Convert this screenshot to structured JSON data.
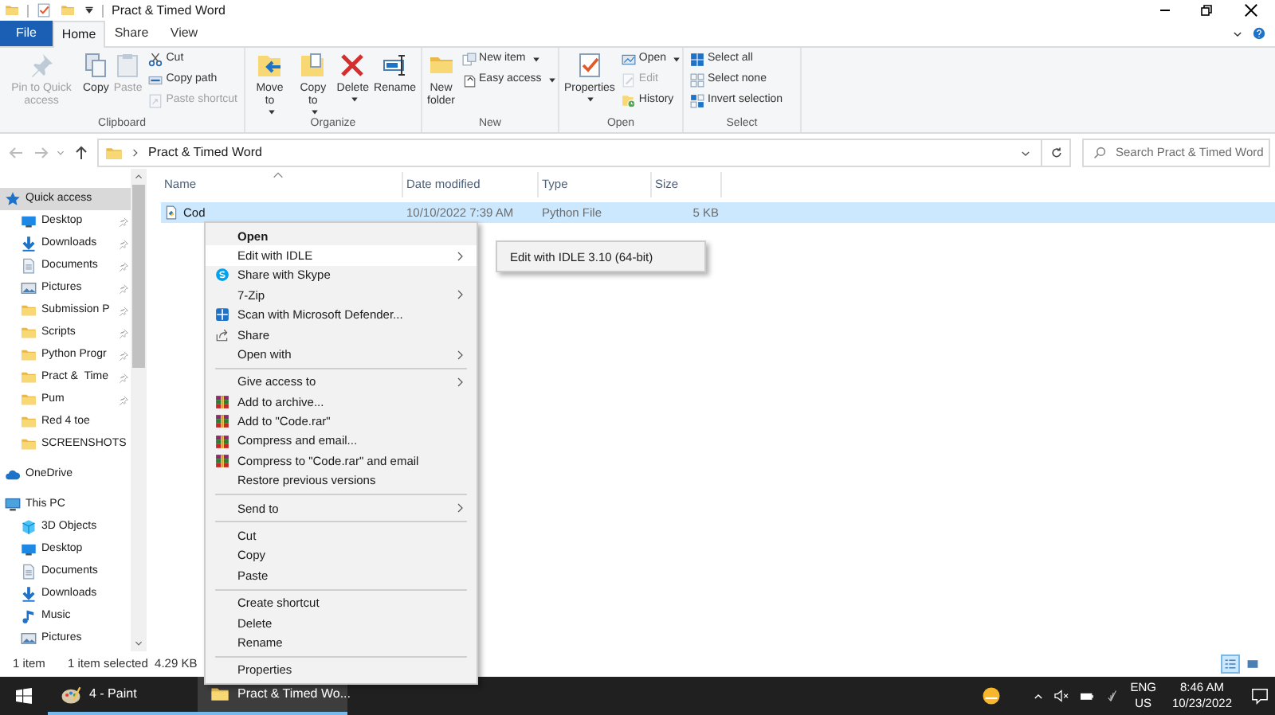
{
  "title_bar": {
    "title": "Pract & Timed Word"
  },
  "ribbon": {
    "tabs": [
      {
        "label": "File",
        "kind": "file",
        "selected": false
      },
      {
        "label": "Home",
        "kind": "tab",
        "selected": true
      },
      {
        "label": "Share",
        "kind": "tab",
        "selected": false
      },
      {
        "label": "View",
        "kind": "tab",
        "selected": false
      }
    ],
    "groups": [
      {
        "label": "Clipboard",
        "items": [
          {
            "label": "Pin to Quick access",
            "kind": "large",
            "dropdown": false,
            "disabled": true
          },
          {
            "label": "Copy",
            "kind": "large",
            "dropdown": false,
            "disabled": false
          },
          {
            "label": "Paste",
            "kind": "large",
            "dropdown": false,
            "disabled": true
          },
          {
            "label": "Cut",
            "kind": "small",
            "dropdown": false,
            "disabled": false
          },
          {
            "label": "Copy path",
            "kind": "small",
            "dropdown": false,
            "disabled": false
          },
          {
            "label": "Paste shortcut",
            "kind": "small",
            "dropdown": false,
            "disabled": true
          }
        ]
      },
      {
        "label": "Organize",
        "items": [
          {
            "label": "Move to",
            "kind": "large",
            "dropdown": true,
            "disabled": false
          },
          {
            "label": "Copy to",
            "kind": "large",
            "dropdown": true,
            "disabled": false
          },
          {
            "label": "Delete",
            "kind": "large",
            "dropdown": true,
            "disabled": false
          },
          {
            "label": "Rename",
            "kind": "large",
            "dropdown": false,
            "disabled": false
          }
        ]
      },
      {
        "label": "New",
        "items": [
          {
            "label": "New folder",
            "kind": "large",
            "dropdown": false,
            "disabled": false
          },
          {
            "label": "New item",
            "kind": "small",
            "dropdown": true,
            "disabled": false
          },
          {
            "label": "Easy access",
            "kind": "small",
            "dropdown": true,
            "disabled": false
          }
        ]
      },
      {
        "label": "Open",
        "items": [
          {
            "label": "Properties",
            "kind": "large",
            "dropdown": true,
            "disabled": false
          },
          {
            "label": "Open",
            "kind": "small",
            "dropdown": true,
            "disabled": false
          },
          {
            "label": "Edit",
            "kind": "small",
            "dropdown": false,
            "disabled": true
          },
          {
            "label": "History",
            "kind": "small",
            "dropdown": false,
            "disabled": false
          }
        ]
      },
      {
        "label": "Select",
        "items": [
          {
            "label": "Select all",
            "kind": "small",
            "dropdown": false,
            "disabled": false
          },
          {
            "label": "Select none",
            "kind": "small",
            "dropdown": false,
            "disabled": false
          },
          {
            "label": "Invert selection",
            "kind": "small",
            "dropdown": false,
            "disabled": false
          }
        ]
      }
    ]
  },
  "address_bar": {
    "path": "Pract & Timed Word",
    "search": {
      "placeholder": "Search Pract & Timed Word"
    }
  },
  "sidebar": {
    "items": [
      {
        "label": "Quick access",
        "selected": true,
        "children": [
          {
            "label": "Desktop",
            "selected": false,
            "pinned": true
          },
          {
            "label": "Downloads",
            "selected": false,
            "pinned": true
          },
          {
            "label": "Documents",
            "selected": false,
            "pinned": true
          },
          {
            "label": "Pictures",
            "selected": false,
            "pinned": true
          },
          {
            "label": "Submission P",
            "selected": false,
            "pinned": true
          },
          {
            "label": "Scripts",
            "selected": false,
            "pinned": true
          },
          {
            "label": "Python Progr",
            "selected": false,
            "pinned": true
          },
          {
            "label": "Pract &  Time",
            "selected": false,
            "pinned": true
          },
          {
            "label": "Pum",
            "selected": false,
            "pinned": true
          },
          {
            "label": "Red 4 toe",
            "selected": false,
            "pinned": false
          },
          {
            "label": "SCREENSHOTS",
            "selected": false,
            "pinned": false
          }
        ]
      },
      {
        "label": "OneDrive",
        "selected": false
      },
      {
        "label": "This PC",
        "selected": false,
        "children": [
          {
            "label": "3D Objects",
            "selected": false,
            "pinned": false
          },
          {
            "label": "Desktop",
            "selected": false,
            "pinned": false
          },
          {
            "label": "Documents",
            "selected": false,
            "pinned": false
          },
          {
            "label": "Downloads",
            "selected": false,
            "pinned": false
          },
          {
            "label": "Music",
            "selected": false,
            "pinned": false
          },
          {
            "label": "Pictures",
            "selected": false,
            "pinned": false
          }
        ]
      }
    ]
  },
  "table": {
    "columns": [
      "Name",
      "Date modified",
      "Type",
      "Size"
    ],
    "rows": [
      {
        "cells": [
          "Cod",
          "10/10/2022 7:39 AM",
          "Python File",
          "5 KB"
        ],
        "selected": true
      }
    ]
  },
  "context_menu": {
    "items": [
      {
        "kind": "item",
        "label": "Open",
        "default": true,
        "submenu": false,
        "highlighted": false
      },
      {
        "kind": "item",
        "label": "Edit with IDLE",
        "default": false,
        "submenu": true,
        "highlighted": true
      },
      {
        "kind": "item",
        "label": "Share with Skype",
        "default": false,
        "submenu": false,
        "highlighted": false
      },
      {
        "kind": "item",
        "label": "7-Zip",
        "default": false,
        "submenu": true,
        "highlighted": false
      },
      {
        "kind": "item",
        "label": "Scan with Microsoft Defender...",
        "default": false,
        "submenu": false,
        "highlighted": false
      },
      {
        "kind": "item",
        "label": "Share",
        "default": false,
        "submenu": false,
        "highlighted": false
      },
      {
        "kind": "item",
        "label": "Open with",
        "default": false,
        "submenu": true,
        "highlighted": false
      },
      {
        "kind": "separator"
      },
      {
        "kind": "item",
        "label": "Give access to",
        "default": false,
        "submenu": true,
        "highlighted": false
      },
      {
        "kind": "item",
        "label": "Add to archive...",
        "default": false,
        "submenu": false,
        "highlighted": false
      },
      {
        "kind": "item",
        "label": "Add to \"Code.rar\"",
        "default": false,
        "submenu": false,
        "highlighted": false
      },
      {
        "kind": "item",
        "label": "Compress and email...",
        "default": false,
        "submenu": false,
        "highlighted": false
      },
      {
        "kind": "item",
        "label": "Compress to \"Code.rar\" and email",
        "default": false,
        "submenu": false,
        "highlighted": false
      },
      {
        "kind": "item",
        "label": "Restore previous versions",
        "default": false,
        "submenu": false,
        "highlighted": false
      },
      {
        "kind": "separator"
      },
      {
        "kind": "item",
        "label": "Send to",
        "default": false,
        "submenu": true,
        "highlighted": false
      },
      {
        "kind": "separator"
      },
      {
        "kind": "item",
        "label": "Cut",
        "default": false,
        "submenu": false,
        "highlighted": false
      },
      {
        "kind": "item",
        "label": "Copy",
        "default": false,
        "submenu": false,
        "highlighted": false
      },
      {
        "kind": "item",
        "label": "Paste",
        "default": false,
        "submenu": false,
        "highlighted": false
      },
      {
        "kind": "separator"
      },
      {
        "kind": "item",
        "label": "Create shortcut",
        "default": false,
        "submenu": false,
        "highlighted": false
      },
      {
        "kind": "item",
        "label": "Delete",
        "default": false,
        "submenu": false,
        "highlighted": false
      },
      {
        "kind": "item",
        "label": "Rename",
        "default": false,
        "submenu": false,
        "highlighted": false
      },
      {
        "kind": "separator"
      },
      {
        "kind": "item",
        "label": "Properties",
        "default": false,
        "submenu": false,
        "highlighted": false
      }
    ],
    "submenu": {
      "items": [
        "Edit with IDLE 3.10 (64-bit)"
      ]
    }
  },
  "status_bar": {
    "count": "1 item",
    "selection": "1 item selected  4.29 KB",
    "views": [
      {
        "kind": "details",
        "selected": true
      },
      {
        "kind": "large_icons",
        "selected": false
      }
    ]
  },
  "taskbar": {
    "apps": [
      {
        "label": "4 - Paint",
        "active": false
      },
      {
        "label": "Pract & Timed Wo...",
        "active": true
      }
    ],
    "language": "ENG",
    "region": "US",
    "time": "8:46 AM",
    "date": "10/23/2022"
  }
}
